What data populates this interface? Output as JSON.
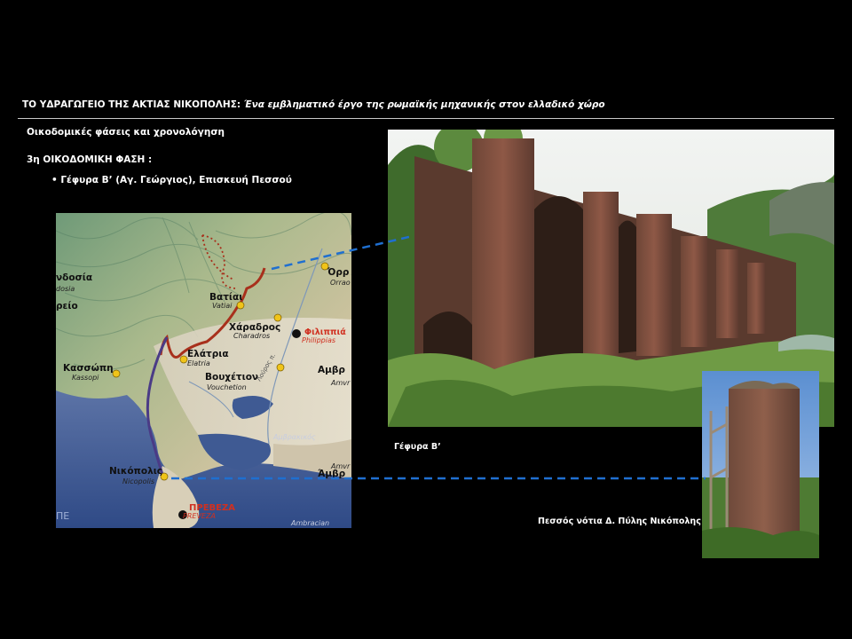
{
  "slide": {
    "title_upright": "ΤΟ ΥΔΡΑΓΩΓΕΙΟ ΤΗΣ ΑΚΤΙΑΣ ΝΙΚΟΠΟΛΗΣ:",
    "title_italic": "Ένα εμβληματικό έργο της ρωμαϊκής μηχανικής στον ελλαδικό χώρο",
    "heading1": "Οικοδομικές φάσεις και χρονολόγηση",
    "heading2": "3η ΟΙΚΟΔΟΜΙΚΗ ΦΑΣΗ :",
    "bullet": "• Γέφυρα Β’ (Αγ. Γεώργιος), Επισκευή Πεσσού",
    "caption_bridge": "Γέφυρα Β’",
    "caption_pillar": "Πεσσός νότια Δ. Πύλης Νικόπολης"
  },
  "map": {
    "places": {
      "nikopolis": "Νικόπολις",
      "nikopolis_lat": "Nicopolis",
      "preveza": "ΠΡΕΒΕΖΑ",
      "preveza_lat": "PREVEZA",
      "elatria": "Ελάτρια",
      "elatria_lat": "Elatria",
      "kassopi": "Κασσώπη",
      "kassopi_lat": "Kassopi",
      "vatiai": "Βατίαι",
      "vatiai_lat": "Vatiai",
      "charadros": "Χάραδρος",
      "charadros_lat": "Charadros",
      "bouchetion": "Βουχέτιον",
      "bouchetion_lat": "Vouchetion",
      "filippias": "Φιλιππιά",
      "filippias_lat": "Philippias",
      "amvr1": "Αμβρ",
      "amvr1_lat": "Amvr",
      "amvr2": "Άμβρ",
      "amvr2_lat": "Amvr",
      "orr": "Όρρ",
      "orr_lat": "Orrao",
      "dosia": "νδοσία",
      "dosia_lat": "dosia",
      "eio": "ρείο",
      "ambrakikos": "Αμβρακικός",
      "ambracian": "Ambracian",
      "louros": "Λούρος π.",
      "pe": "ΠΕ"
    },
    "colors": {
      "route_red": "#a8301c",
      "route_purple": "#4a3b86",
      "dashed_blue": "#1f6fd0",
      "settlement": "#f0c419"
    }
  }
}
